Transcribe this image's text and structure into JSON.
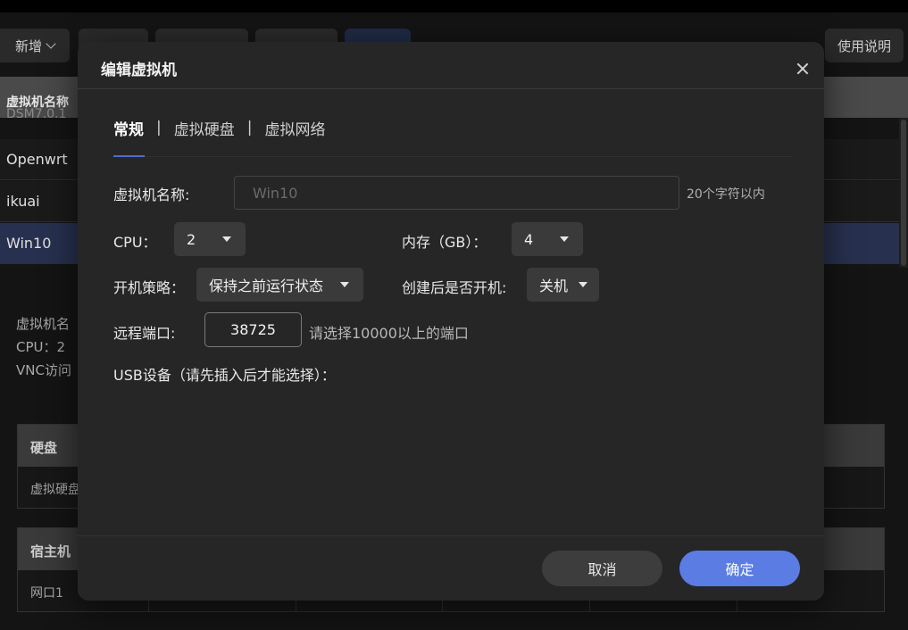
{
  "toolbar": {
    "new_label": "新增",
    "help_label": "使用说明"
  },
  "list": {
    "header": "虚拟机名称",
    "ghost_row": "DSM7.0.1",
    "rows": [
      "Openwrt",
      "ikuai",
      "Win10"
    ]
  },
  "details": {
    "line1": "虚拟机名",
    "line2": "CPU：2",
    "line3": "VNC访问"
  },
  "disk_panel": {
    "header": "硬盘",
    "row": "虚拟硬盘"
  },
  "host_panel": {
    "header": "宿主机",
    "row": "网口1"
  },
  "modal": {
    "title": "编辑虚拟机",
    "tabs": [
      "常规",
      "虚拟硬盘",
      "虚拟网络"
    ],
    "tab_divider": "|",
    "name_label": "虚拟机名称:",
    "name_placeholder": "Win10",
    "name_hint": "20个字符以内",
    "cpu_label": "CPU：",
    "cpu_value": "2",
    "memory_label": "内存（GB）：",
    "memory_value": "4",
    "boot_policy_label": "开机策略：",
    "boot_policy_value": "保持之前运行状态",
    "start_after_create_label": "创建后是否开机:",
    "start_after_create_value": "关机",
    "port_label": "远程端口:",
    "port_value": "38725",
    "port_hint": "请选择10000以上的端口",
    "usb_label": "USB设备（请先插入后才能选择）：",
    "cancel_label": "取消",
    "ok_label": "确定"
  },
  "colors": {
    "accent": "#5b7ce3",
    "selected_row": "#27314f",
    "modal_bg": "#262626"
  },
  "icons": [
    "chevron-down-icon",
    "close-icon",
    "caret-down-icon"
  ]
}
